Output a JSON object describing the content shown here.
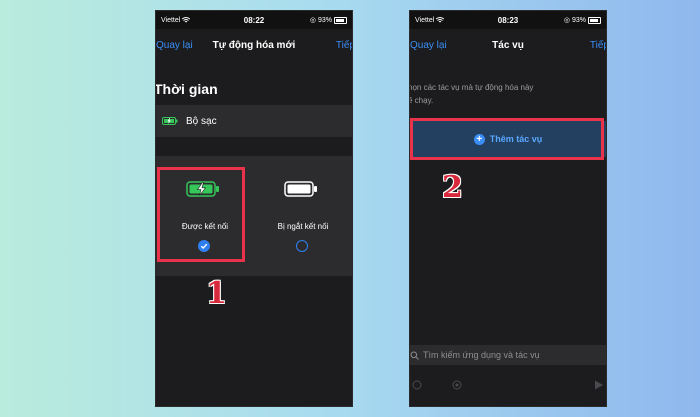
{
  "phone1": {
    "status": {
      "carrier": "Viettel",
      "time": "08:22",
      "battery": "93%"
    },
    "nav": {
      "back": "Quay lại",
      "title": "Tự động hóa mới",
      "next": "Tiếp"
    },
    "section_title": "Thời gian",
    "charger_label": "Bộ sạc",
    "option_connected": "Được kết nối",
    "option_disconnected": "Bị ngắt kết nối",
    "step": "1"
  },
  "phone2": {
    "status": {
      "carrier": "Viettel",
      "time": "08:23",
      "battery": "93%"
    },
    "nav": {
      "back": "Quay lại",
      "title": "Tác vụ",
      "next": "Tiếp"
    },
    "description": "họn các tác vụ mà tự động hóa này\nẽ chạy.",
    "add_action": "Thêm tác vụ",
    "search_placeholder": "Tìm kiếm ứng dụng và tác vụ",
    "step": "2"
  },
  "colors": {
    "accent": "#3a8ef6",
    "highlight": "#e8334a",
    "battery_green": "#35c759"
  }
}
